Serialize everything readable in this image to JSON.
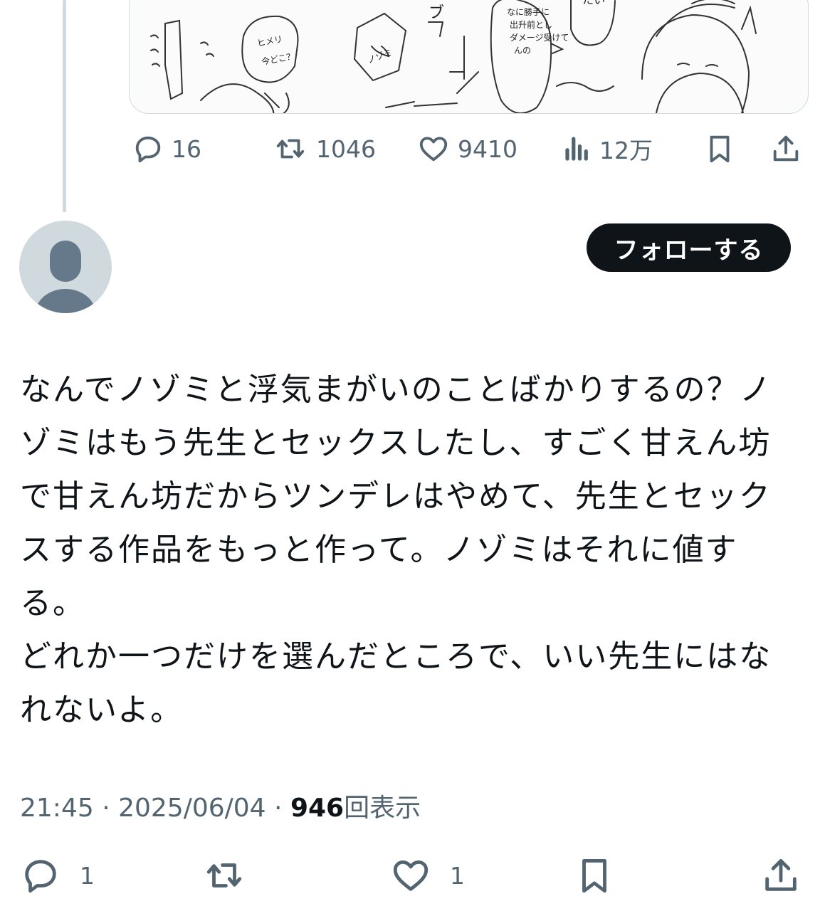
{
  "parent_tweet": {
    "media_description": "manga sketch",
    "actions": {
      "reply_count": "16",
      "retweet_count": "1046",
      "like_count": "9410",
      "views_count": "12万"
    }
  },
  "reply_tweet": {
    "follow_label": "フォローする",
    "text_lines": [
      "なんでノゾミと浮気まがいのことばかりするの？ノゾミはもう先生とセックスしたし、すごく甘えん坊で甘えん坊だからツンデレはやめて、先生とセックスする作品をもっと作って。ノゾミはそれに値する。",
      "どれか一つだけを選んだところで、いい先生にはなれないよ。"
    ],
    "time": "21:45",
    "date": "2025/06/04",
    "views_number": "946",
    "views_label": "回表示",
    "actions": {
      "reply_count": "1",
      "like_count": "1"
    }
  },
  "colors": {
    "text": "#0f1419",
    "muted": "#536471",
    "border": "#cfd9de",
    "button_bg": "#0f1419"
  }
}
